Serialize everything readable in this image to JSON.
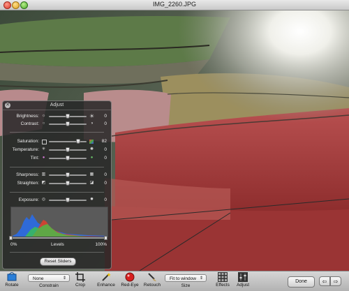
{
  "window": {
    "title": "IMG_2260.JPG"
  },
  "hud": {
    "title": "Adjust",
    "sliders": [
      {
        "label": "Brightness:",
        "value": "0",
        "level": 0.5
      },
      {
        "label": "Contrast:",
        "value": "0",
        "level": 0.5
      },
      {
        "label": "Saturation:",
        "value": "82",
        "level": 0.82
      },
      {
        "label": "Temperature:",
        "value": "0",
        "level": 0.5
      },
      {
        "label": "Tint:",
        "value": "0",
        "level": 0.5
      },
      {
        "label": "Sharpness:",
        "value": "0",
        "level": 0.5
      },
      {
        "label": "Straighten:",
        "value": "0",
        "level": 0.5
      },
      {
        "label": "Exposure:",
        "value": "0",
        "level": 0.5
      }
    ],
    "levels": {
      "low_label": "0%",
      "title": "Levels",
      "high_label": "100%"
    },
    "reset_label": "Reset Sliders"
  },
  "toolbar": {
    "rotate_label": "Rotate",
    "constrain_value": "None",
    "constrain_label": "Constrain",
    "crop_label": "Crop",
    "enhance_label": "Enhance",
    "redeye_label": "Red-Eye",
    "retouch_label": "Retouch",
    "size_value": "Fit to window",
    "size_label": "Size",
    "effects_label": "Effects",
    "adjust_label": "Adjust",
    "done_label": "Done"
  }
}
